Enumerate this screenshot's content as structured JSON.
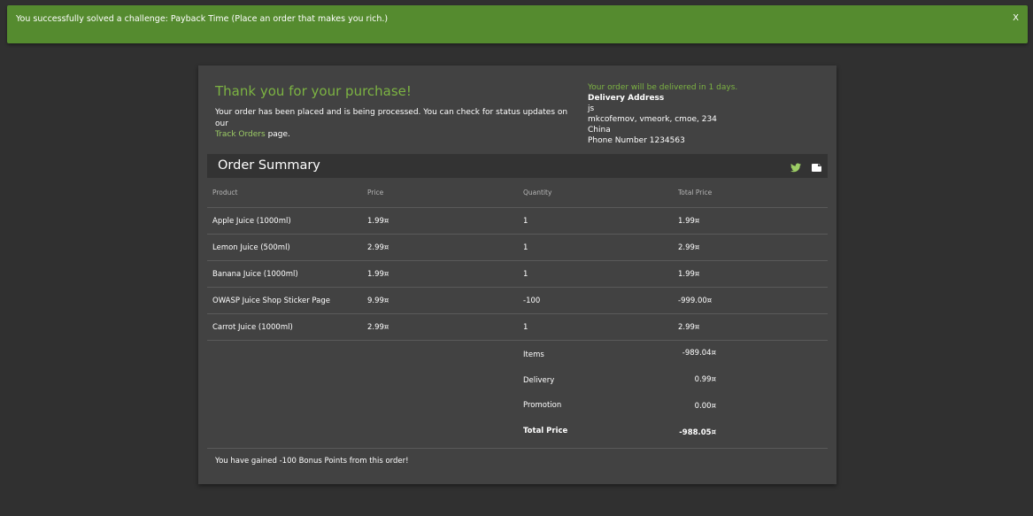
{
  "banner": {
    "message": "You successfully solved a challenge: Payback Time (Place an order that makes you rich.)",
    "close_label": "X"
  },
  "confirmation": {
    "thanks": "Thank you for your purchase!",
    "placed_text": "Your order has been placed and is being processed. You can check for status updates on our",
    "track_link": "Track Orders",
    "placed_suffix": "page."
  },
  "delivery": {
    "eta": "Your order will be delivered in 1 days.",
    "heading": "Delivery Address",
    "name": "js",
    "street": "mkcofemov, vmeork, cmoe, 234",
    "country": "China",
    "phone": "Phone Number 1234563"
  },
  "summary": {
    "title": "Order Summary",
    "icons": [
      "twitter-icon",
      "print-icon"
    ]
  },
  "table": {
    "headers": [
      "Product",
      "Price",
      "Quantity",
      "Total Price"
    ],
    "rows": [
      [
        "Apple Juice (1000ml)",
        "1.99¤",
        "1",
        "1.99¤"
      ],
      [
        "Lemon Juice (500ml)",
        "2.99¤",
        "1",
        "2.99¤"
      ],
      [
        "Banana Juice (1000ml)",
        "1.99¤",
        "1",
        "1.99¤"
      ],
      [
        "OWASP Juice Shop Sticker Page",
        "9.99¤",
        "-100",
        "-999.00¤"
      ],
      [
        "Carrot Juice (1000ml)",
        "2.99¤",
        "1",
        "2.99¤"
      ]
    ]
  },
  "totals": {
    "items_label": "Items",
    "items_value": "-989.04¤",
    "delivery_label": "Delivery",
    "delivery_value": "0.99¤",
    "promotion_label": "Promotion",
    "promotion_value": "0.00¤",
    "total_label": "Total Price",
    "total_value": "-988.05¤"
  },
  "bonus": "You have gained -100 Bonus Points from this order!",
  "colors": {
    "background": "#303030",
    "card": "#424242",
    "banner": "#558b2f",
    "accent_green": "#7cb342"
  }
}
